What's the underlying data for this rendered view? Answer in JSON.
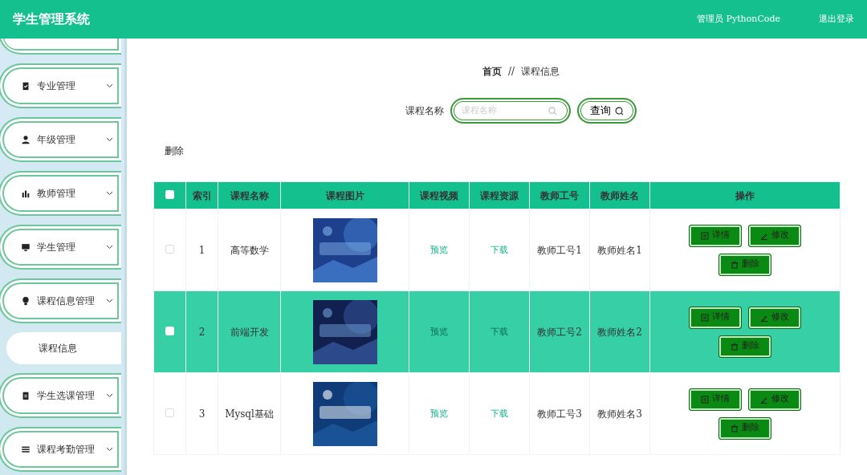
{
  "header": {
    "title": "学生管理系统",
    "user": "管理员 PythonCode",
    "logout": "退出登录"
  },
  "sidebar": {
    "items": [
      {
        "label": "专业管理"
      },
      {
        "label": "年级管理"
      },
      {
        "label": "教师管理"
      },
      {
        "label": "学生管理"
      },
      {
        "label": "课程信息管理",
        "children": [
          {
            "label": "课程信息",
            "selected": true
          }
        ]
      },
      {
        "label": "学生选课管理"
      },
      {
        "label": "课程考勤管理"
      }
    ]
  },
  "breadcrumb": {
    "home": "首页",
    "separator": "//",
    "current": "课程信息"
  },
  "search": {
    "label": "课程名称",
    "placeholder": "课程名称",
    "button": "查询"
  },
  "delete_button": "删除",
  "table": {
    "columns": [
      "索引",
      "课程名称",
      "课程图片",
      "课程视频",
      "课程资源",
      "教师工号",
      "教师姓名",
      "操作"
    ],
    "header_checked": false,
    "rows": [
      {
        "checked": false,
        "highlighted": false,
        "index": "1",
        "name": "高等数学",
        "video": "预览",
        "resource": "下载",
        "teacher_id": "教师工号1",
        "teacher_name": "教师姓名1",
        "actions": [
          "详情",
          "修改",
          "删除"
        ]
      },
      {
        "checked": false,
        "highlighted": true,
        "index": "2",
        "name": "前端开发",
        "video": "预览",
        "resource": "下载",
        "teacher_id": "教师工号2",
        "teacher_name": "教师姓名2",
        "actions": [
          "详情",
          "修改",
          "删除"
        ]
      },
      {
        "checked": false,
        "highlighted": false,
        "index": "3",
        "name": "Mysql基础",
        "video": "预览",
        "resource": "下载",
        "teacher_id": "教师工号3",
        "teacher_name": "教师姓名3",
        "actions": [
          "详情",
          "修改",
          "删除"
        ]
      }
    ]
  }
}
